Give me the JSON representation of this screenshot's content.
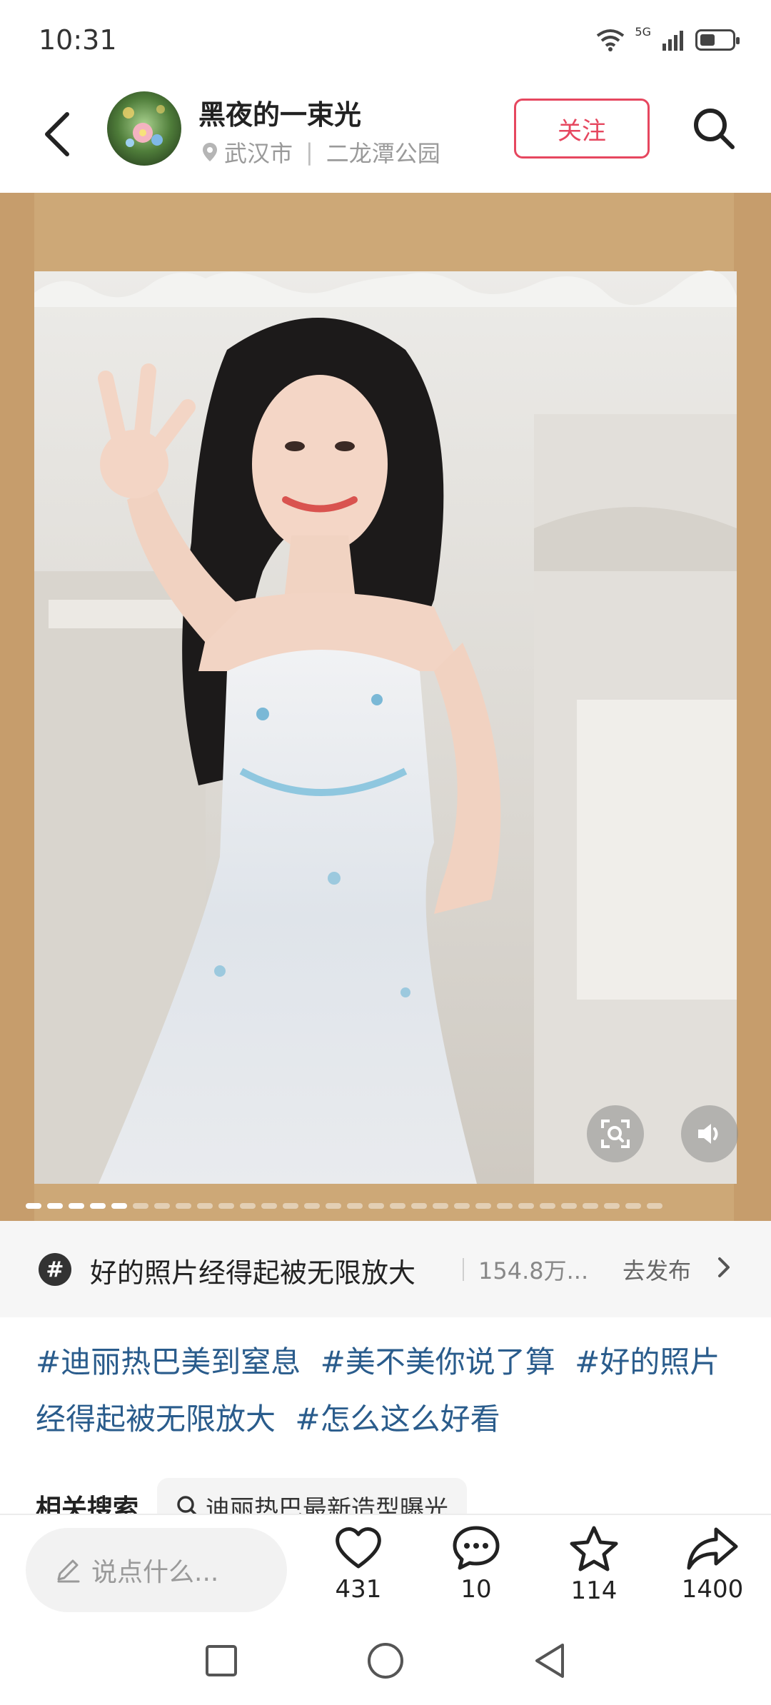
{
  "status_bar": {
    "time": "10:31",
    "network": "5G",
    "battery_level": 0.45
  },
  "header": {
    "username": "黑夜的一束光",
    "location_city": "武汉市",
    "location_place": "二龙潭公园",
    "follow_label": "关注"
  },
  "media": {
    "page_count": 30,
    "active_page": 5
  },
  "topic": {
    "title": "好的照片经得起被无限放大",
    "count": "154.8万...",
    "action_label": "去发布"
  },
  "hashtags": [
    "#迪丽热巴美到窒息",
    "#美不美你说了算",
    "#好的照片经得起被无限放大",
    "#怎么这么好看"
  ],
  "related_search": {
    "label": "相关搜索",
    "query": "迪丽热巴最新造型曝光"
  },
  "bottom_bar": {
    "comment_placeholder": "说点什么...",
    "likes": "431",
    "comments": "10",
    "favorites": "114",
    "shares": "1400"
  },
  "colors": {
    "accent": "#e6475f",
    "hashtag": "#2a5c8c",
    "frame": "#cda877"
  }
}
